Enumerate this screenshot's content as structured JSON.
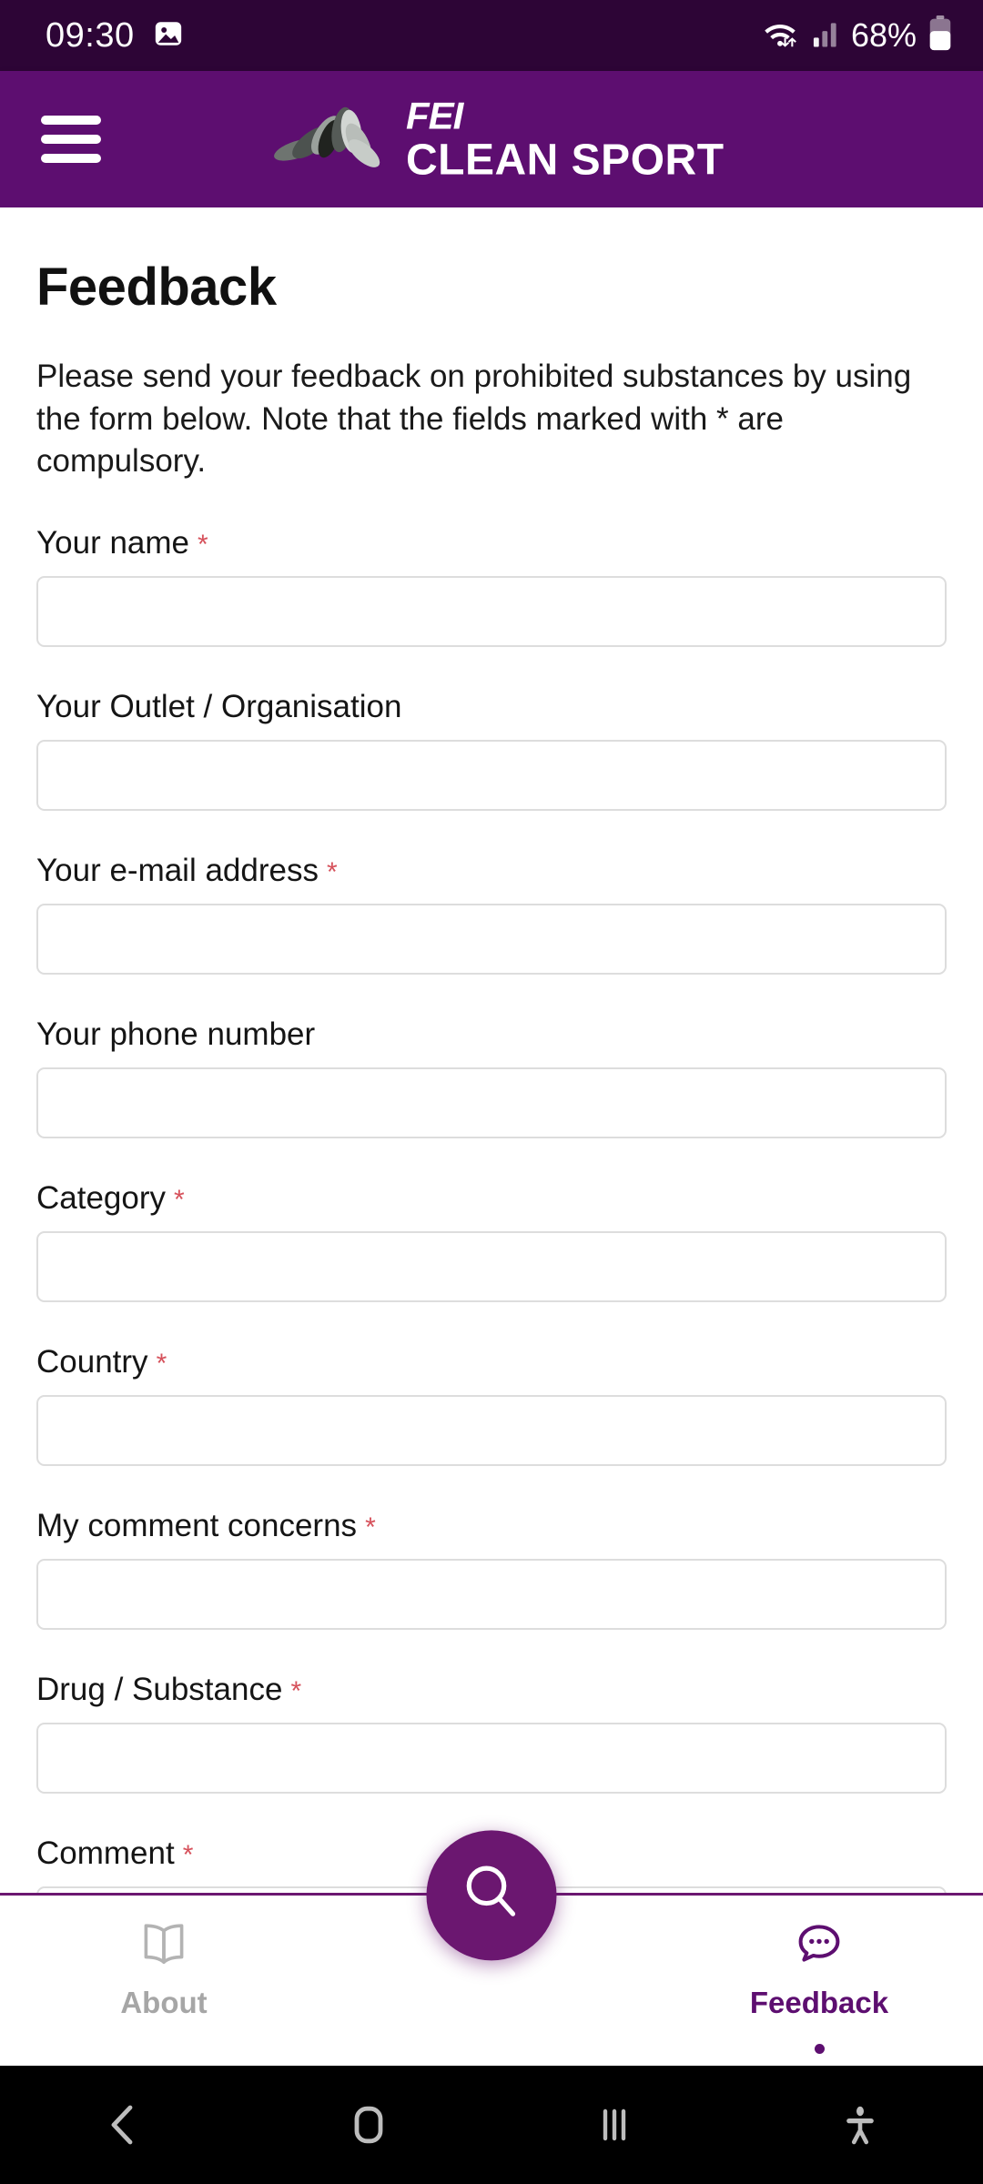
{
  "status_bar": {
    "time": "09:30",
    "battery_percent": "68%",
    "icons": [
      "image-notification-icon",
      "wifi-icon",
      "cellular-signal-icon",
      "battery-icon"
    ],
    "background_color": "#2d0536"
  },
  "header": {
    "menu_icon": "hamburger-menu-icon",
    "logo_icon": "fei-lotus-logo",
    "brand_line1": "FEI",
    "brand_line2": "CLEAN SPORT",
    "background_color": "#5d0e70"
  },
  "page": {
    "title": "Feedback",
    "intro": "Please send your feedback on prohibited substances by using the form below. Note that the fields marked with * are compulsory.",
    "required_marker": "*",
    "required_color": "#d6515b"
  },
  "form": {
    "fields": [
      {
        "label": "Your name",
        "required": true,
        "value": "",
        "placeholder": ""
      },
      {
        "label": "Your Outlet / Organisation",
        "required": false,
        "value": "",
        "placeholder": ""
      },
      {
        "label": "Your e-mail address",
        "required": true,
        "value": "",
        "placeholder": ""
      },
      {
        "label": "Your phone number",
        "required": false,
        "value": "",
        "placeholder": ""
      },
      {
        "label": "Category",
        "required": true,
        "value": "",
        "placeholder": ""
      },
      {
        "label": "Country",
        "required": true,
        "value": "",
        "placeholder": ""
      },
      {
        "label": "My comment concerns",
        "required": true,
        "value": "",
        "placeholder": ""
      },
      {
        "label": "Drug / Substance",
        "required": true,
        "value": "",
        "placeholder": ""
      },
      {
        "label": "Comment",
        "required": true,
        "value": "",
        "placeholder": ""
      }
    ]
  },
  "bottom_nav": {
    "tabs": [
      {
        "label": "About",
        "icon": "book-icon",
        "active": false
      },
      {
        "label": "Feedback",
        "icon": "chat-bubble-icon",
        "active": true
      }
    ],
    "fab": {
      "icon": "search-icon",
      "color": "#6b1770"
    },
    "accent_color": "#5d0e70"
  },
  "android_nav": {
    "buttons": [
      "back-icon",
      "home-icon",
      "recents-icon",
      "accessibility-icon"
    ],
    "background_color": "#000000"
  }
}
